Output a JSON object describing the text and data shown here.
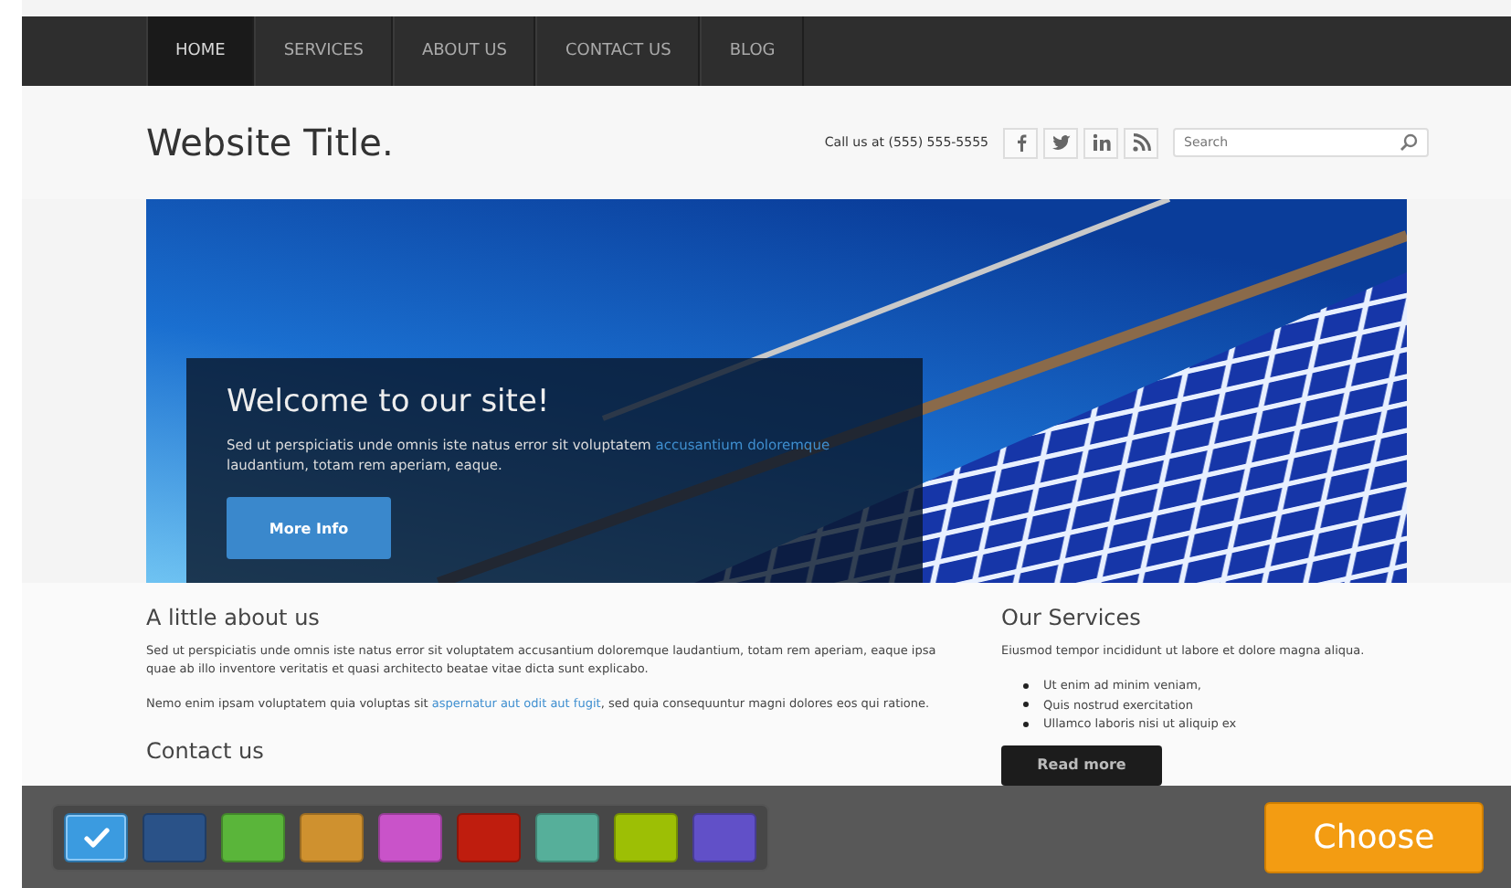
{
  "nav": {
    "items": [
      {
        "label": "HOME",
        "selected": true
      },
      {
        "label": "SERVICES",
        "selected": false
      },
      {
        "label": "ABOUT US",
        "selected": false
      },
      {
        "label": "CONTACT US",
        "selected": false
      },
      {
        "label": "BLOG",
        "selected": false
      }
    ]
  },
  "header": {
    "title": "Website Title.",
    "phone": "Call us at (555) 555-5555",
    "search": {
      "placeholder": "Search"
    }
  },
  "hero": {
    "title": "Welcome to our site!",
    "text": "Sed ut perspiciatis unde omnis iste natus error sit voluptatem",
    "link": "accusantium doloremque",
    "text_after": "laudantium, totam rem aperiam, eaque.",
    "button": "More Info"
  },
  "about": {
    "heading": "A little about us",
    "paragraph": "Sed ut perspiciatis unde omnis iste natus error sit voluptatem accusantium doloremque laudantium, totam rem aperiam, eaque ipsa quae ab illo inventore veritatis et quasi architecto beatae vitae dicta sunt explicabo.",
    "paragraph_2": {
      "before": "Nemo enim ipsam voluptatem quia voluptas sit",
      "link": "aspernatur aut odit aut fugit",
      "after": ", sed quia consequuntur magni dolores eos qui ratione."
    },
    "contact_heading": "Contact us"
  },
  "services": {
    "heading": "Our Services",
    "paragraph": "Eiusmod tempor incididunt ut labore et dolore magna aliqua.",
    "list": [
      "Ut enim ad minim veniam,",
      "Quis nostrud exercitation",
      "Ullamco laboris nisi ut aliquip ex"
    ],
    "button": "Read more"
  },
  "chooser": {
    "swatches": [
      {
        "color": "#3b9be0",
        "selected": true
      },
      {
        "color": "#2a5288",
        "selected": false
      },
      {
        "color": "#5ab53a",
        "selected": false
      },
      {
        "color": "#cf912f",
        "selected": false
      },
      {
        "color": "#c953c9",
        "selected": false
      },
      {
        "color": "#bf1d0e",
        "selected": false
      },
      {
        "color": "#56af9a",
        "selected": false
      },
      {
        "color": "#9dbf05",
        "selected": false
      },
      {
        "color": "#6150c8",
        "selected": false
      }
    ],
    "button": "Choose"
  }
}
